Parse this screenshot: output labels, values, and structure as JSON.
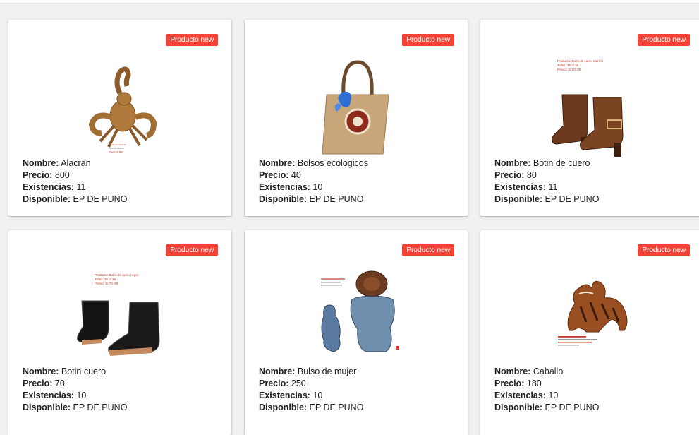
{
  "products": [
    {
      "badge": "Producto new",
      "nombre_label": "Nombre:",
      "nombre": "Alacran",
      "precio_label": "Precio:",
      "precio": "800",
      "existencias_label": "Existencias:",
      "existencias": "11",
      "disponible_label": "Disponible:",
      "disponible": "EP DE PUNO"
    },
    {
      "badge": "Producto new",
      "nombre_label": "Nombre:",
      "nombre": "Bolsos ecologicos",
      "precio_label": "Precio:",
      "precio": "40",
      "existencias_label": "Existencias:",
      "existencias": "10",
      "disponible_label": "Disponible:",
      "disponible": "EP DE PUNO"
    },
    {
      "badge": "Producto new",
      "nombre_label": "Nombre:",
      "nombre": "Botin de cuero",
      "precio_label": "Precio:",
      "precio": "80",
      "existencias_label": "Existencias:",
      "existencias": "11",
      "disponible_label": "Disponible:",
      "disponible": "EP DE PUNO"
    },
    {
      "badge": "Producto new",
      "nombre_label": "Nombre:",
      "nombre": "Botin cuero",
      "precio_label": "Precio:",
      "precio": "70",
      "existencias_label": "Existencias:",
      "existencias": "10",
      "disponible_label": "Disponible:",
      "disponible": "EP DE PUNO"
    },
    {
      "badge": "Producto new",
      "nombre_label": "Nombre:",
      "nombre": "Bulso de mujer",
      "precio_label": "Precio:",
      "precio": "250",
      "existencias_label": "Existencias:",
      "existencias": "10",
      "disponible_label": "Disponible:",
      "disponible": "EP DE PUNO"
    },
    {
      "badge": "Producto new",
      "nombre_label": "Nombre:",
      "nombre": "Caballo",
      "precio_label": "Precio:",
      "precio": "180",
      "existencias_label": "Existencias:",
      "existencias": "10",
      "disponible_label": "Disponible:",
      "disponible": "EP DE PUNO"
    }
  ],
  "image_captions": {
    "botin_cuero_marron": {
      "producto": "Producto: Botín de cuero marrón",
      "tallas": "Tallas: 36 al 39",
      "precio": "Precio: S/ 80. 00"
    },
    "botin_cuero_negro": {
      "producto": "Producto: Botín de cuero negro",
      "tallas": "Tallas: 36 al 39",
      "precio": "Precio: S/ 70. 00"
    }
  },
  "colors": {
    "badge": "#f44336",
    "card": "#ffffff",
    "background": "#f1f1f1",
    "text": "#212121"
  }
}
